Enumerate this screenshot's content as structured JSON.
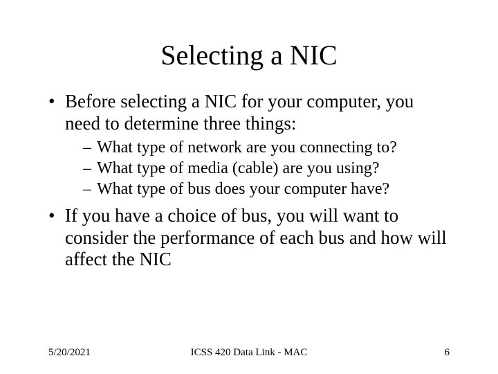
{
  "title": "Selecting a NIC",
  "bullets": [
    {
      "text": "Before selecting a NIC for your computer, you need to determine three things:",
      "sub": [
        "What type of network are you connecting to?",
        "What type of media (cable) are you using?",
        "What type of bus does your computer have?"
      ]
    },
    {
      "text": "If you have a choice of bus, you will want to consider the performance of each bus and how will affect the NIC",
      "sub": []
    }
  ],
  "footer": {
    "date": "5/20/2021",
    "course": "ICSS 420 Data Link - MAC",
    "page": "6"
  }
}
